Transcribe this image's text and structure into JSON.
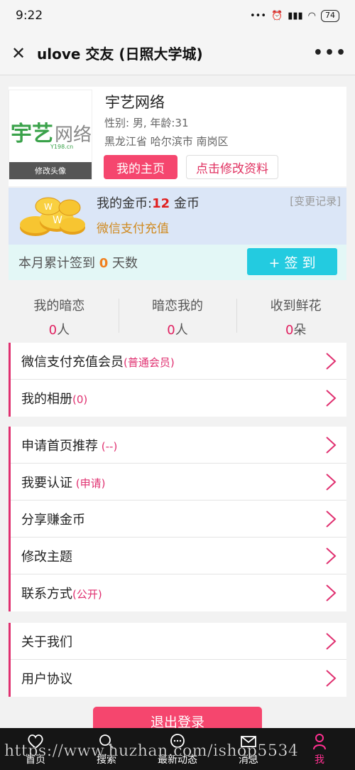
{
  "status_bar": {
    "time": "9:22",
    "battery": "74"
  },
  "title_bar": {
    "title": "ulove 交友 (日照大学城)"
  },
  "profile": {
    "avatar_logo_cn": "宇艺",
    "avatar_logo_cn2": "网络",
    "avatar_logo_url": "Y198.cn",
    "avatar_label": "修改头像",
    "name": "宇艺网络",
    "info": "性别: 男, 年龄:31",
    "location": "黑龙江省 哈尔滨市 南岗区",
    "home_button": "我的主页",
    "edit_button": "点击修改资料"
  },
  "coins": {
    "label": "我的金币:",
    "amount": "12",
    "unit": " 金币",
    "change_log": "[变更记录]",
    "recharge": "微信支付充值"
  },
  "sign": {
    "prefix": "本月累计签到",
    "days": "0",
    "suffix": "天数",
    "button": "+ 签 到"
  },
  "stats": [
    {
      "label": "我的暗恋",
      "value": "0",
      "unit": "人"
    },
    {
      "label": "暗恋我的",
      "value": "0",
      "unit": "人"
    },
    {
      "label": "收到鲜花",
      "value": "0",
      "unit": "朵"
    }
  ],
  "menu_group_1": [
    {
      "label": "微信支付充值会员",
      "sub": "(普通会员)"
    },
    {
      "label": "我的相册",
      "sub": "(0)"
    }
  ],
  "menu_group_2": [
    {
      "label": "申请首页推荐",
      "sub": " (--)"
    },
    {
      "label": "我要认证",
      "sub": " (申请)"
    },
    {
      "label": "分享赚金币",
      "sub": ""
    },
    {
      "label": "修改主题",
      "sub": ""
    },
    {
      "label": "联系方式",
      "sub": "(公开)"
    }
  ],
  "menu_group_3": [
    {
      "label": "关于我们",
      "sub": ""
    },
    {
      "label": "用户协议",
      "sub": ""
    }
  ],
  "logout": "退出登录",
  "tabbar": [
    {
      "label": "首页",
      "icon": "heart-icon"
    },
    {
      "label": "搜索",
      "icon": "search-icon"
    },
    {
      "label": "最新动态",
      "icon": "chat-icon"
    },
    {
      "label": "消息",
      "icon": "mail-icon"
    },
    {
      "label": "我",
      "icon": "user-icon"
    }
  ],
  "watermark": "https://www.huzhan.com/ishop5534",
  "colors": {
    "accent": "#f5466e",
    "sign_button": "#23cbe0",
    "active_tab": "#ff3090"
  }
}
